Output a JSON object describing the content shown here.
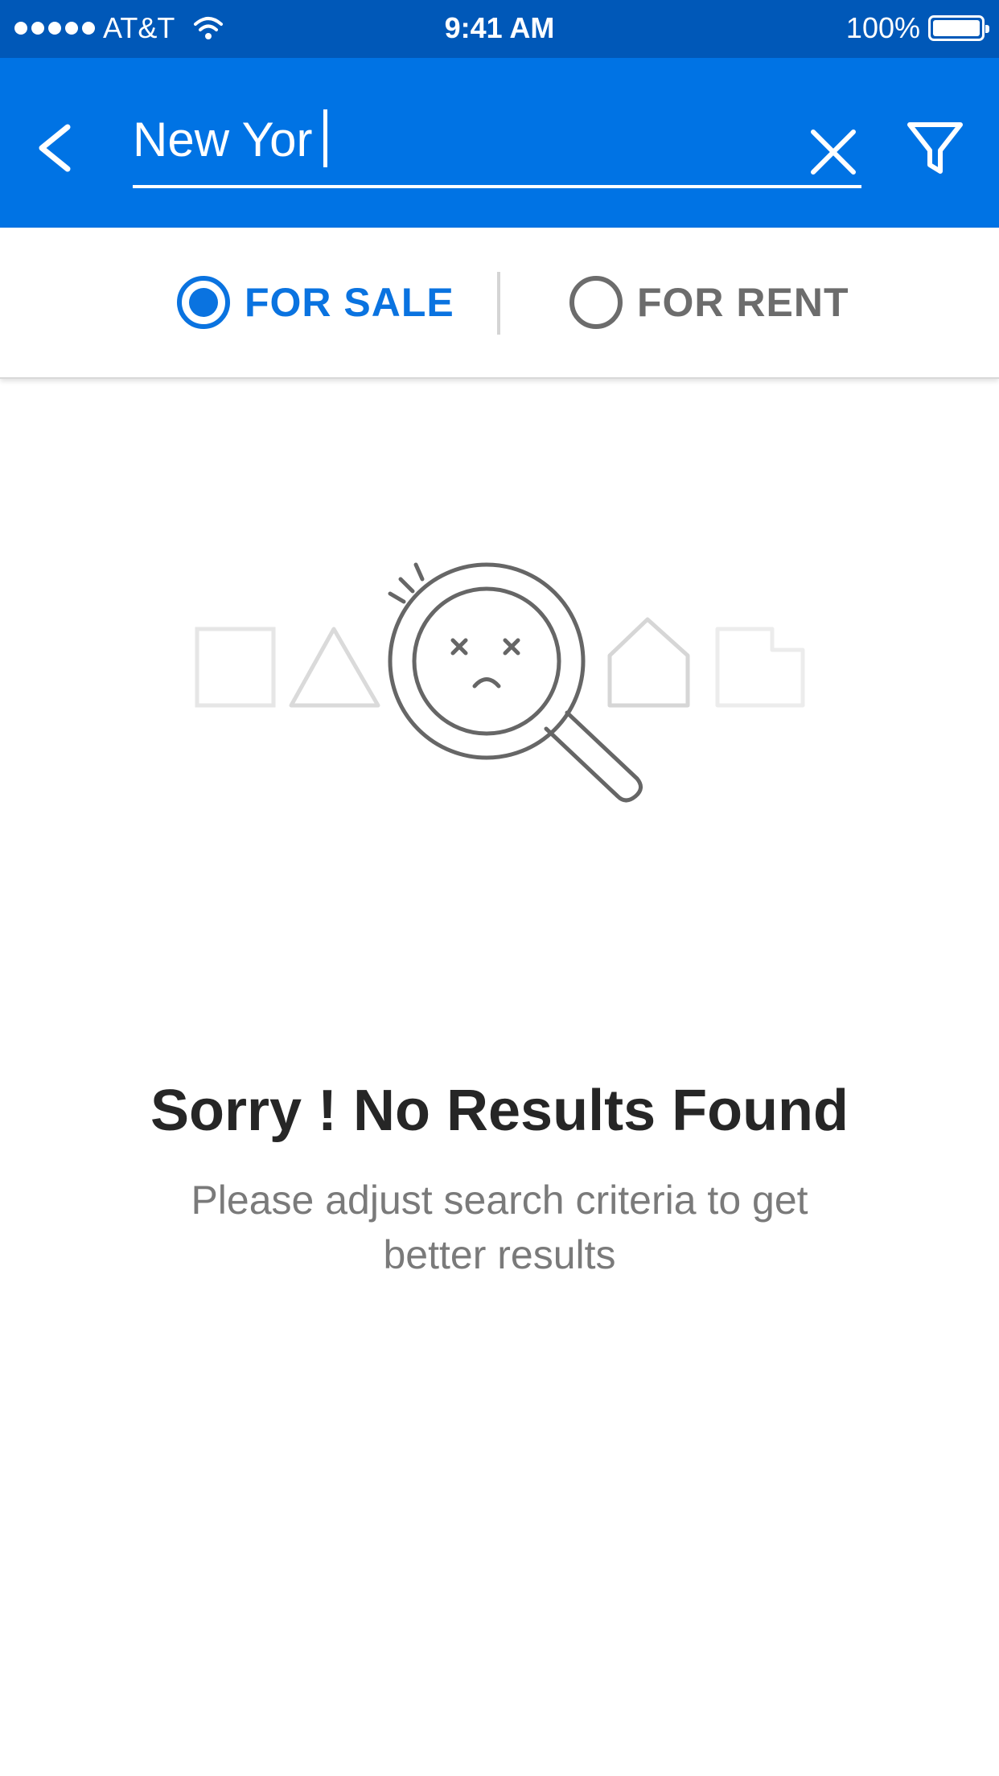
{
  "status_bar": {
    "carrier": "AT&T",
    "time": "9:41 AM",
    "battery": "100%"
  },
  "search": {
    "value": "New Yor",
    "back_icon": "chevron-left-icon",
    "clear_icon": "close-icon",
    "filter_icon": "filter-icon"
  },
  "listing_type": {
    "options": [
      {
        "label": "FOR SALE",
        "selected": true
      },
      {
        "label": "FOR RENT",
        "selected": false
      }
    ]
  },
  "empty_state": {
    "illustration_icon": "magnifier-sad-face-icon",
    "title": "Sorry ! No Results Found",
    "subtitle": "Please adjust search criteria to get better results"
  },
  "colors": {
    "status_bar": "#0058b8",
    "app_bar": "#0073e4",
    "accent": "#0a73e0",
    "inactive": "#6c6c6c"
  }
}
